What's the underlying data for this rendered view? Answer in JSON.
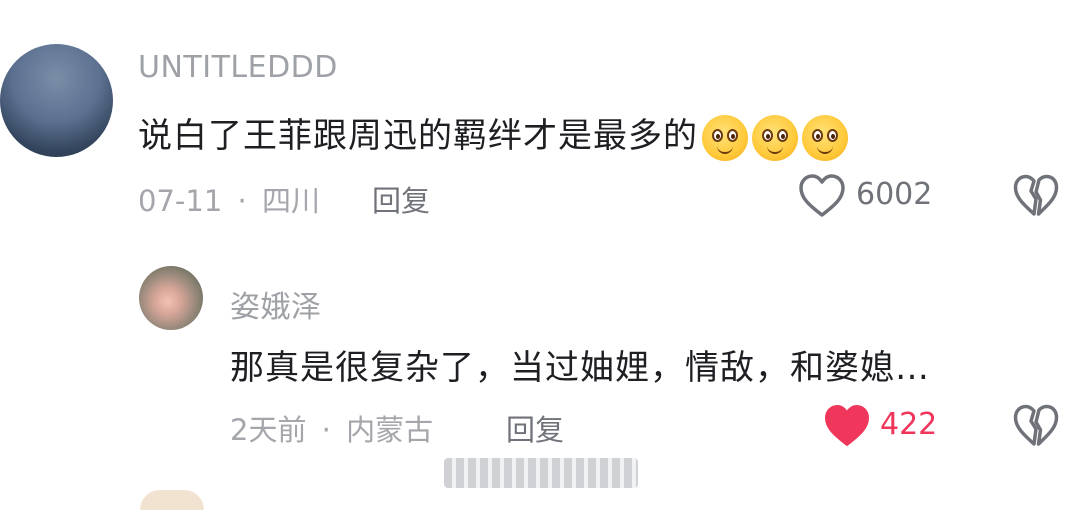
{
  "comment": {
    "username": "UNTITLEDDD",
    "text": "说白了王菲跟周迅的羁绊才是最多的",
    "emojis": [
      "grinning-face-emoji",
      "grinning-face-emoji",
      "grinning-face-emoji"
    ],
    "date": "07-11",
    "location": "四川",
    "reply_label": "回复",
    "like_count": "6002",
    "liked": false
  },
  "reply": {
    "username": "姿娥泽",
    "text": "那真是很复杂了，当过妯娌，情敌，和婆媳…",
    "date": "2天前",
    "location": "内蒙古",
    "reply_label": "回复",
    "like_count": "422",
    "liked": true
  },
  "colors": {
    "like_active": "#f0365a",
    "icon_gray": "#707279",
    "meta_gray": "#a4a6ab"
  },
  "separator": "·"
}
